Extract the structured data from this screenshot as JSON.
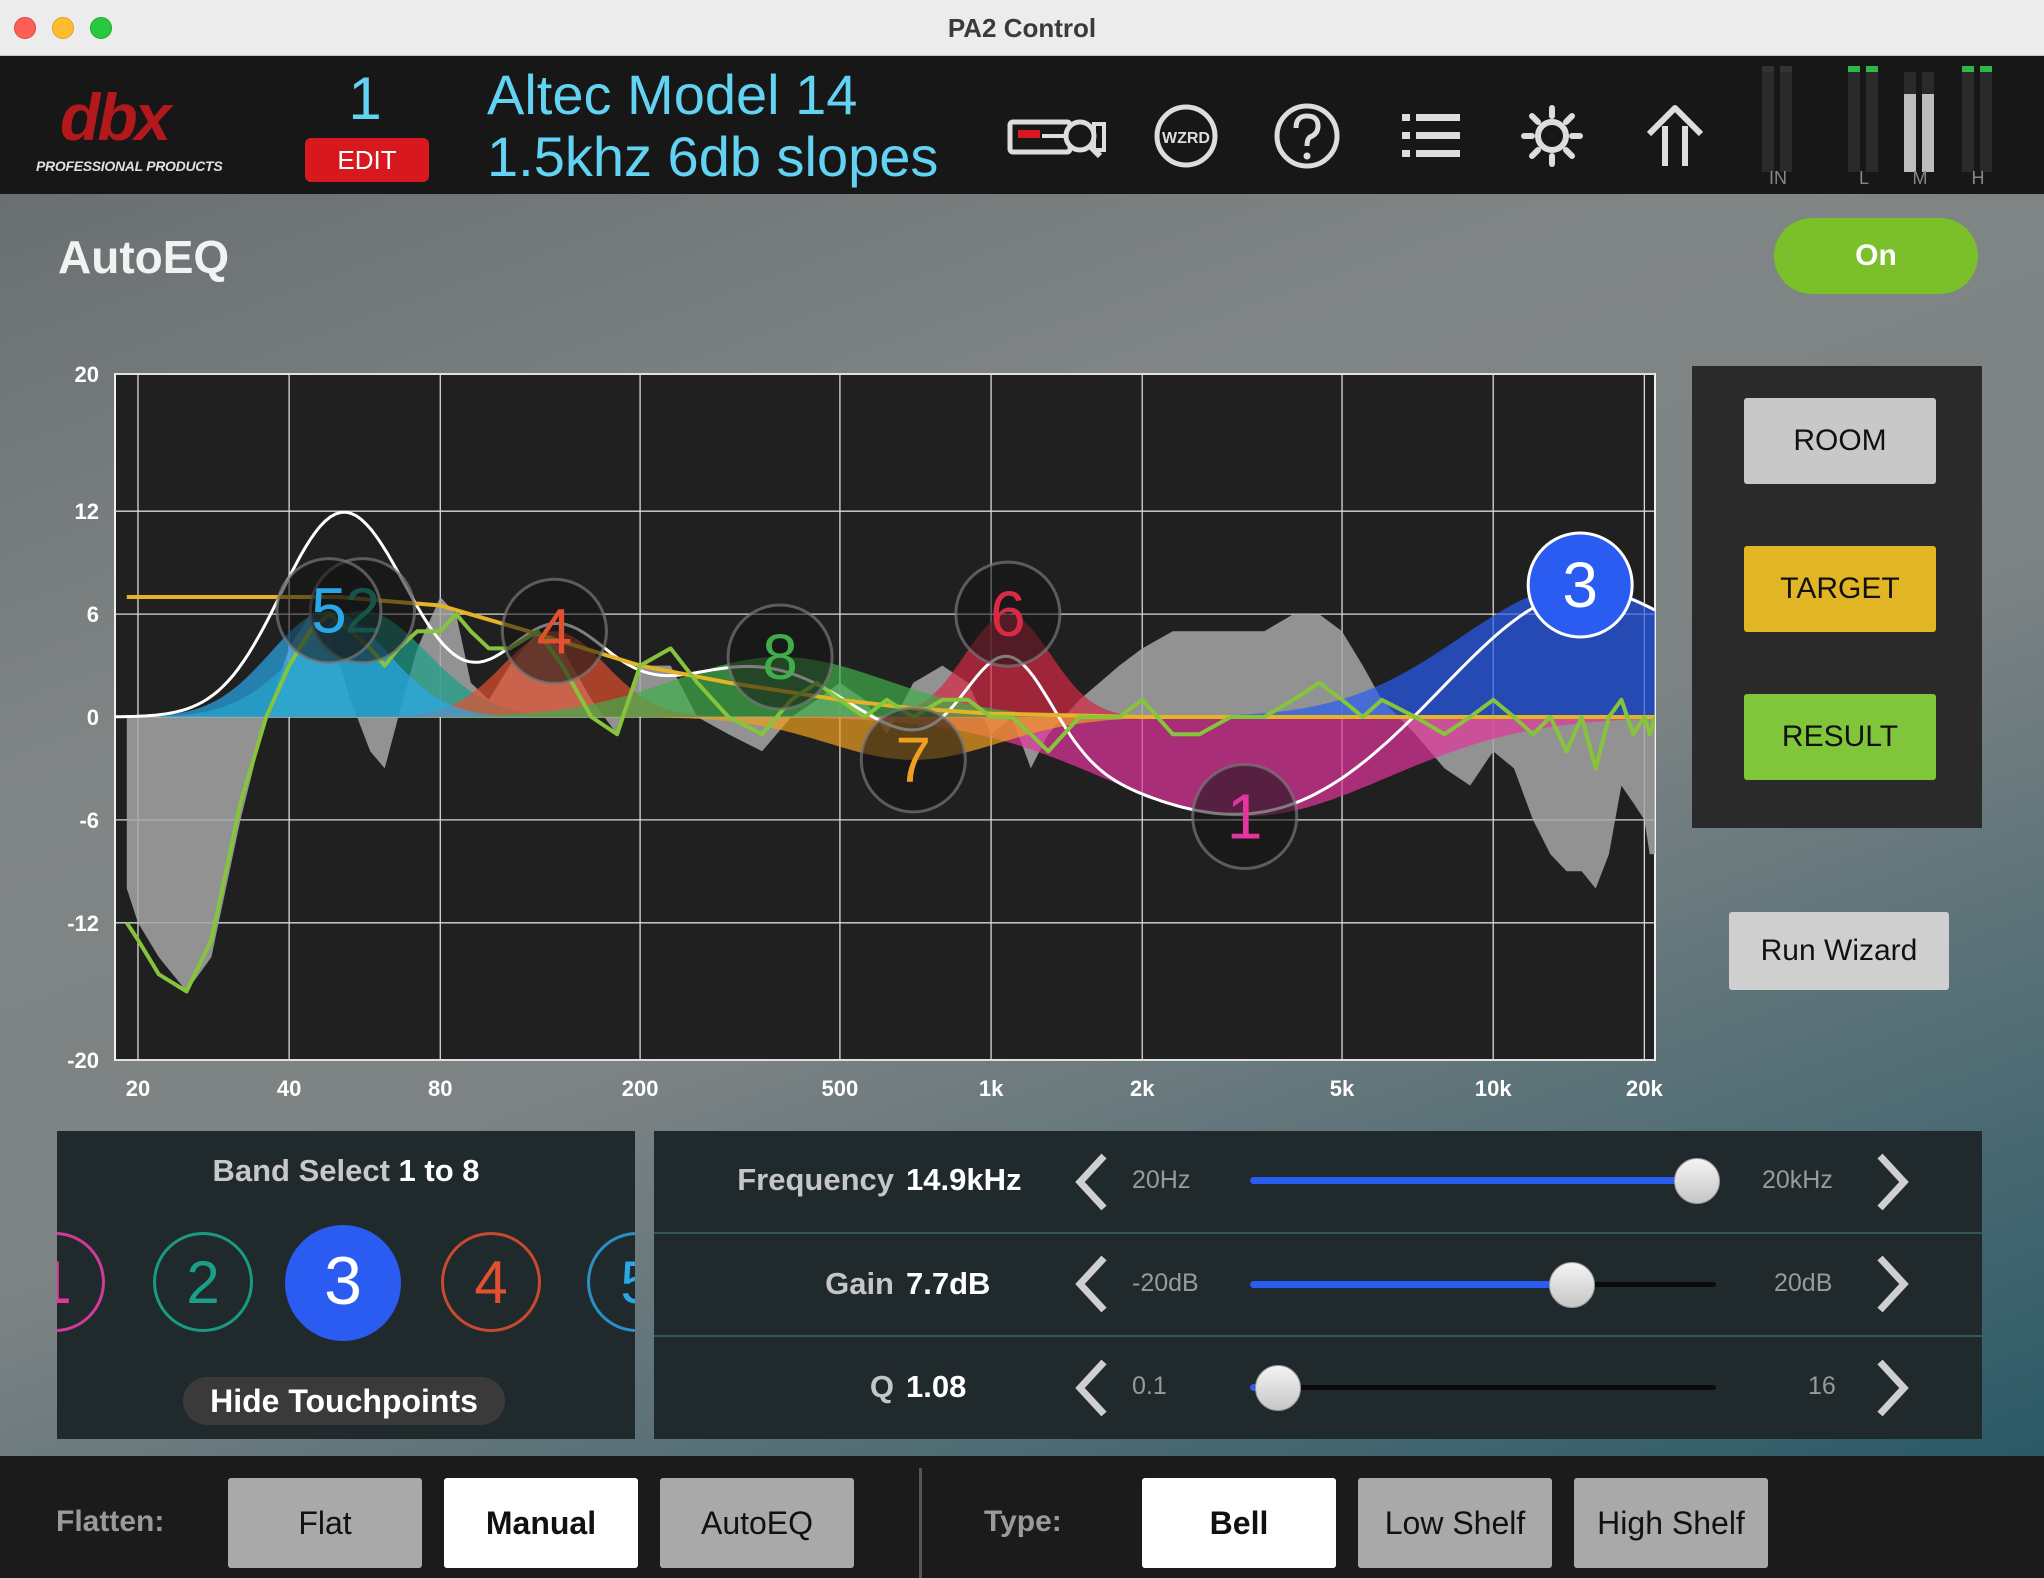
{
  "window": {
    "title": "PA2 Control"
  },
  "header": {
    "logo_main": "dbx",
    "logo_sub": "PROFESSIONAL PRODUCTS",
    "preset_number": "1",
    "edit_label": "EDIT",
    "preset_name_line1": "Altec Model 14",
    "preset_name_line2": "1.5khz 6db slopes",
    "icons": [
      "rta-mic-icon",
      "wizard-icon",
      "help-icon",
      "list-icon",
      "settings-gear-icon",
      "home-arrow-icon"
    ],
    "wizard_icon_text": "WZRD",
    "meters": [
      {
        "label": "IN"
      },
      {
        "label": "L"
      },
      {
        "label": "M"
      },
      {
        "label": "H"
      }
    ]
  },
  "page": {
    "title": "AutoEQ",
    "on_label": "On"
  },
  "side_panel": {
    "room": "ROOM",
    "target": "TARGET",
    "result": "RESULT",
    "run_wizard": "Run Wizard"
  },
  "band_select": {
    "title_prefix": "Band Select",
    "title_range": "1 to 8",
    "visible_bands": [
      "1",
      "2",
      "3",
      "4",
      "5"
    ],
    "selected_band": "3",
    "hide_touchpoints": "Hide Touchpoints"
  },
  "params": {
    "frequency": {
      "name": "Frequency",
      "value": "14.9kHz",
      "min": "20Hz",
      "max": "20kHz",
      "level": 0.96
    },
    "gain": {
      "name": "Gain",
      "value": "7.7dB",
      "min": "-20dB",
      "max": "20dB",
      "level": 0.69
    },
    "q": {
      "name": "Q",
      "value": "1.08",
      "min": "0.1",
      "max": "16",
      "level": 0.06
    }
  },
  "bottom": {
    "flatten_label": "Flatten:",
    "flatten_options": [
      "Flat",
      "Manual",
      "AutoEQ"
    ],
    "flatten_selected": "Manual",
    "type_label": "Type:",
    "type_options": [
      "Bell",
      "Low Shelf",
      "High Shelf"
    ],
    "type_selected": "Bell"
  },
  "chart_data": {
    "type": "line",
    "x_scale": "log",
    "xlim": [
      18,
      21000
    ],
    "ylim": [
      -20,
      20
    ],
    "x_ticks": [
      20,
      40,
      80,
      200,
      500,
      1000,
      2000,
      5000,
      10000,
      20000
    ],
    "x_tick_labels": [
      "20",
      "40",
      "80",
      "200",
      "500",
      "1k",
      "2k",
      "5k",
      "10k",
      "20k"
    ],
    "y_ticks": [
      20,
      12,
      6,
      0,
      -6,
      -12,
      -20
    ],
    "y_tick_labels": [
      "20",
      "12",
      "6",
      "0",
      "-6",
      "-12",
      "-20"
    ],
    "grid": true,
    "colors": {
      "room": "#a7a7a7",
      "target": "#e4b326",
      "result": "#86c43b",
      "combined": "#ffffff"
    },
    "bands": [
      {
        "number": "1",
        "freq": 3200,
        "gain": -5.8,
        "q": 0.9,
        "color": "#e4349e"
      },
      {
        "number": "2",
        "freq": 56,
        "gain": 6.2,
        "q": 2.0,
        "color": "#1aa08a"
      },
      {
        "number": "3",
        "freq": 14900,
        "gain": 7.7,
        "q": 1.08,
        "color": "#2a5cf2"
      },
      {
        "number": "4",
        "freq": 135,
        "gain": 5.0,
        "q": 2.5,
        "color": "#e2502f"
      },
      {
        "number": "5",
        "freq": 48,
        "gain": 6.2,
        "q": 2.2,
        "color": "#29a8e8"
      },
      {
        "number": "6",
        "freq": 1080,
        "gain": 6.0,
        "q": 3.0,
        "color": "#d62a45"
      },
      {
        "number": "7",
        "freq": 700,
        "gain": -2.5,
        "q": 1.5,
        "color": "#f0a020"
      },
      {
        "number": "8",
        "freq": 380,
        "gain": 3.5,
        "q": 1.2,
        "color": "#3fae49"
      }
    ],
    "series": [
      {
        "name": "ROOM",
        "points": [
          [
            19,
            -10
          ],
          [
            20,
            -12
          ],
          [
            22,
            -14
          ],
          [
            25,
            -16
          ],
          [
            28,
            -14
          ],
          [
            32,
            -6
          ],
          [
            36,
            0
          ],
          [
            40,
            4
          ],
          [
            44,
            6
          ],
          [
            48,
            5
          ],
          [
            53,
            1
          ],
          [
            58,
            -2
          ],
          [
            62,
            -3
          ],
          [
            66,
            0
          ],
          [
            72,
            4
          ],
          [
            80,
            7
          ],
          [
            86,
            6
          ],
          [
            92,
            2
          ],
          [
            100,
            1
          ],
          [
            110,
            3
          ],
          [
            125,
            5
          ],
          [
            140,
            4
          ],
          [
            160,
            1
          ],
          [
            180,
            -1
          ],
          [
            200,
            3
          ],
          [
            230,
            3
          ],
          [
            260,
            0
          ],
          [
            300,
            -1
          ],
          [
            350,
            -2
          ],
          [
            400,
            0
          ],
          [
            450,
            1
          ],
          [
            500,
            2
          ],
          [
            560,
            1
          ],
          [
            620,
            -1
          ],
          [
            700,
            2
          ],
          [
            800,
            3
          ],
          [
            900,
            2
          ],
          [
            1000,
            -1
          ],
          [
            1100,
            0
          ],
          [
            1200,
            -3
          ],
          [
            1300,
            -1
          ],
          [
            1500,
            1
          ],
          [
            1800,
            3
          ],
          [
            2000,
            4
          ],
          [
            2300,
            5
          ],
          [
            2600,
            5
          ],
          [
            3000,
            5
          ],
          [
            3500,
            5
          ],
          [
            4000,
            6
          ],
          [
            4500,
            6
          ],
          [
            5000,
            5
          ],
          [
            5500,
            3
          ],
          [
            6000,
            1
          ],
          [
            7000,
            -1
          ],
          [
            8000,
            -3
          ],
          [
            9000,
            -4
          ],
          [
            10000,
            -2
          ],
          [
            11000,
            -3
          ],
          [
            12000,
            -6
          ],
          [
            13000,
            -8
          ],
          [
            14000,
            -9
          ],
          [
            15000,
            -9
          ],
          [
            16000,
            -10
          ],
          [
            17000,
            -8
          ],
          [
            18000,
            -4
          ],
          [
            19000,
            -5
          ],
          [
            20000,
            -6
          ],
          [
            20500,
            -8
          ],
          [
            21000,
            -8
          ]
        ]
      },
      {
        "name": "TARGET",
        "points": [
          [
            19,
            7
          ],
          [
            30,
            7
          ],
          [
            50,
            7
          ],
          [
            80,
            6.5
          ],
          [
            120,
            5
          ],
          [
            200,
            3
          ],
          [
            300,
            2
          ],
          [
            500,
            1
          ],
          [
            700,
            0.5
          ],
          [
            1000,
            0.2
          ],
          [
            2000,
            0
          ],
          [
            5000,
            0
          ],
          [
            21000,
            0
          ]
        ]
      },
      {
        "name": "RESULT",
        "points": [
          [
            19,
            -12
          ],
          [
            20,
            -13
          ],
          [
            22,
            -15
          ],
          [
            25,
            -16
          ],
          [
            28,
            -13
          ],
          [
            32,
            -5
          ],
          [
            36,
            0
          ],
          [
            40,
            3
          ],
          [
            44,
            5
          ],
          [
            48,
            6
          ],
          [
            53,
            5
          ],
          [
            58,
            4
          ],
          [
            62,
            3
          ],
          [
            66,
            4
          ],
          [
            72,
            5
          ],
          [
            80,
            5
          ],
          [
            86,
            6
          ],
          [
            92,
            5
          ],
          [
            100,
            4
          ],
          [
            110,
            4
          ],
          [
            125,
            5
          ],
          [
            140,
            3
          ],
          [
            160,
            0
          ],
          [
            180,
            -1
          ],
          [
            200,
            3
          ],
          [
            230,
            4
          ],
          [
            260,
            2
          ],
          [
            300,
            0
          ],
          [
            350,
            -1
          ],
          [
            400,
            1
          ],
          [
            450,
            2
          ],
          [
            500,
            1
          ],
          [
            560,
            0
          ],
          [
            620,
            1
          ],
          [
            700,
            0
          ],
          [
            800,
            1
          ],
          [
            900,
            1
          ],
          [
            1000,
            0
          ],
          [
            1100,
            0
          ],
          [
            1200,
            -1
          ],
          [
            1300,
            -2
          ],
          [
            1500,
            0
          ],
          [
            1800,
            0
          ],
          [
            2000,
            1
          ],
          [
            2300,
            -1
          ],
          [
            2600,
            -1
          ],
          [
            3000,
            0
          ],
          [
            3500,
            0
          ],
          [
            4000,
            1
          ],
          [
            4500,
            2
          ],
          [
            5000,
            1
          ],
          [
            5500,
            0
          ],
          [
            6000,
            1
          ],
          [
            7000,
            0
          ],
          [
            8000,
            -1
          ],
          [
            9000,
            0
          ],
          [
            10000,
            1
          ],
          [
            11000,
            0
          ],
          [
            12000,
            -1
          ],
          [
            13000,
            0
          ],
          [
            14000,
            -2
          ],
          [
            15000,
            0
          ],
          [
            16000,
            -3
          ],
          [
            17000,
            0
          ],
          [
            18000,
            1
          ],
          [
            19000,
            -1
          ],
          [
            20000,
            0
          ],
          [
            20500,
            -1
          ],
          [
            21000,
            0
          ]
        ]
      }
    ]
  }
}
